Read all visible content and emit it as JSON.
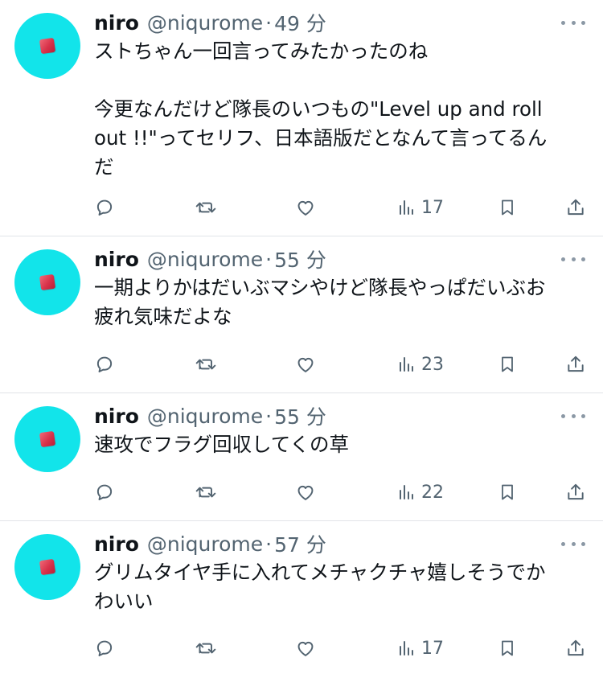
{
  "tweets": [
    {
      "name": "niro",
      "handle": "@niqurome",
      "separator": "·",
      "time": "49 分",
      "text": "ストちゃん一回言ってみたかったのね\n\n今更なんだけど隊長のいつもの\"Level up and roll\nout !!\"ってセリフ、日本語版だとなんて言ってるん\nだ",
      "views": "17"
    },
    {
      "name": "niro",
      "handle": "@niqurome",
      "separator": "·",
      "time": "55 分",
      "text": "一期よりかはだいぶマシやけど隊長やっぱだいぶお\n疲れ気味だよな",
      "views": "23"
    },
    {
      "name": "niro",
      "handle": "@niqurome",
      "separator": "·",
      "time": "55 分",
      "text": "速攻でフラグ回収してくの草",
      "views": "22"
    },
    {
      "name": "niro",
      "handle": "@niqurome",
      "separator": "·",
      "time": "57 分",
      "text": "グリムタイヤ手に入れてメチャクチャ嬉しそうでか\nわいい",
      "views": "17"
    }
  ],
  "colors": {
    "avatar_bg": "#12e4ea",
    "text": "#0f1419",
    "muted": "#536471",
    "divider": "#e1e4e8"
  },
  "icons": [
    "reply-icon",
    "retweet-icon",
    "like-icon",
    "views-icon",
    "bookmark-icon",
    "share-icon",
    "more-icon"
  ]
}
